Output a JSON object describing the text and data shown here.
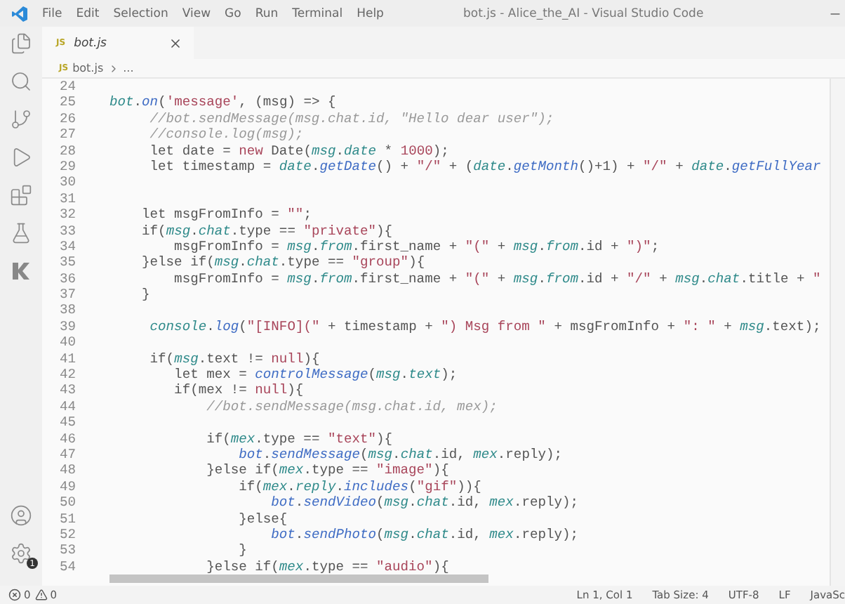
{
  "window": {
    "title": "bot.js - Alice_the_AI - Visual Studio Code"
  },
  "menu": [
    "File",
    "Edit",
    "Selection",
    "View",
    "Go",
    "Run",
    "Terminal",
    "Help"
  ],
  "activity_bar": {
    "items": [
      {
        "kind": "files"
      },
      {
        "kind": "search"
      },
      {
        "kind": "source-control"
      },
      {
        "kind": "run"
      },
      {
        "kind": "extensions"
      },
      {
        "kind": "testing"
      },
      {
        "kind": "k-logo"
      }
    ],
    "bottom": [
      {
        "kind": "account"
      },
      {
        "kind": "settings",
        "badge": "1"
      }
    ]
  },
  "tabs": [
    {
      "icon_text": "JS",
      "label": "bot.js",
      "selected": true
    }
  ],
  "breadcrumb": {
    "icon_text": "JS",
    "file": "bot.js",
    "rest": "..."
  },
  "editor": {
    "lines": [
      {
        "number": "24"
      },
      {
        "number": "25",
        "tokens": [
          {
            "text": "bot",
            "kind": "var"
          },
          {
            "text": ".",
            "kind": "text"
          },
          {
            "text": "on",
            "kind": "func"
          },
          {
            "text": "(",
            "kind": "text"
          },
          {
            "text": "'message'",
            "kind": "string"
          },
          {
            "text": ", (msg) => {",
            "kind": "text"
          }
        ]
      },
      {
        "number": "26",
        "tokens": [
          {
            "text": "     //bot.sendMessage(msg.chat.id, \"Hello dear user\");",
            "kind": "comment"
          }
        ]
      },
      {
        "number": "27",
        "tokens": [
          {
            "text": "     //console.log(msg);",
            "kind": "comment"
          }
        ]
      },
      {
        "number": "28",
        "tokens": [
          {
            "text": "     let date = ",
            "kind": "text"
          },
          {
            "text": "new",
            "kind": "keyword"
          },
          {
            "text": " Date(",
            "kind": "text"
          },
          {
            "text": "msg",
            "kind": "var"
          },
          {
            "text": ".",
            "kind": "text"
          },
          {
            "text": "date",
            "kind": "var"
          },
          {
            "text": " * ",
            "kind": "text"
          },
          {
            "text": "1000",
            "kind": "number"
          },
          {
            "text": ");",
            "kind": "text"
          }
        ]
      },
      {
        "number": "29",
        "tokens": [
          {
            "text": "     let timestamp = ",
            "kind": "text"
          },
          {
            "text": "date",
            "kind": "var"
          },
          {
            "text": ".",
            "kind": "text"
          },
          {
            "text": "getDate",
            "kind": "func"
          },
          {
            "text": "() + ",
            "kind": "text"
          },
          {
            "text": "\"/\"",
            "kind": "string"
          },
          {
            "text": " + (",
            "kind": "text"
          },
          {
            "text": "date",
            "kind": "var"
          },
          {
            "text": ".",
            "kind": "text"
          },
          {
            "text": "getMonth",
            "kind": "func"
          },
          {
            "text": "()+1) + ",
            "kind": "text"
          },
          {
            "text": "\"/\"",
            "kind": "string"
          },
          {
            "text": " + ",
            "kind": "text"
          },
          {
            "text": "date",
            "kind": "var"
          },
          {
            "text": ".",
            "kind": "text"
          },
          {
            "text": "getFullYear",
            "kind": "func"
          }
        ]
      },
      {
        "number": "30"
      },
      {
        "number": "31"
      },
      {
        "number": "32",
        "tokens": [
          {
            "text": "    let msgFromInfo = ",
            "kind": "text"
          },
          {
            "text": "\"\"",
            "kind": "string"
          },
          {
            "text": ";",
            "kind": "text"
          }
        ]
      },
      {
        "number": "33",
        "tokens": [
          {
            "text": "    if(",
            "kind": "text"
          },
          {
            "text": "msg",
            "kind": "var"
          },
          {
            "text": ".",
            "kind": "text"
          },
          {
            "text": "chat",
            "kind": "var"
          },
          {
            "text": ".type == ",
            "kind": "text"
          },
          {
            "text": "\"private\"",
            "kind": "string"
          },
          {
            "text": "){",
            "kind": "text"
          }
        ]
      },
      {
        "number": "34",
        "tokens": [
          {
            "text": "        msgFromInfo = ",
            "kind": "text"
          },
          {
            "text": "msg",
            "kind": "var"
          },
          {
            "text": ".",
            "kind": "text"
          },
          {
            "text": "from",
            "kind": "var"
          },
          {
            "text": ".first_name + ",
            "kind": "text"
          },
          {
            "text": "\"(\"",
            "kind": "string"
          },
          {
            "text": " + ",
            "kind": "text"
          },
          {
            "text": "msg",
            "kind": "var"
          },
          {
            "text": ".",
            "kind": "text"
          },
          {
            "text": "from",
            "kind": "var"
          },
          {
            "text": ".id + ",
            "kind": "text"
          },
          {
            "text": "\")\"",
            "kind": "string"
          },
          {
            "text": ";",
            "kind": "text"
          }
        ]
      },
      {
        "number": "35",
        "tokens": [
          {
            "text": "    }else if(",
            "kind": "text"
          },
          {
            "text": "msg",
            "kind": "var"
          },
          {
            "text": ".",
            "kind": "text"
          },
          {
            "text": "chat",
            "kind": "var"
          },
          {
            "text": ".type == ",
            "kind": "text"
          },
          {
            "text": "\"group\"",
            "kind": "string"
          },
          {
            "text": "){",
            "kind": "text"
          }
        ]
      },
      {
        "number": "36",
        "tokens": [
          {
            "text": "        msgFromInfo = ",
            "kind": "text"
          },
          {
            "text": "msg",
            "kind": "var"
          },
          {
            "text": ".",
            "kind": "text"
          },
          {
            "text": "from",
            "kind": "var"
          },
          {
            "text": ".first_name + ",
            "kind": "text"
          },
          {
            "text": "\"(\"",
            "kind": "string"
          },
          {
            "text": " + ",
            "kind": "text"
          },
          {
            "text": "msg",
            "kind": "var"
          },
          {
            "text": ".",
            "kind": "text"
          },
          {
            "text": "from",
            "kind": "var"
          },
          {
            "text": ".id + ",
            "kind": "text"
          },
          {
            "text": "\"/\"",
            "kind": "string"
          },
          {
            "text": " + ",
            "kind": "text"
          },
          {
            "text": "msg",
            "kind": "var"
          },
          {
            "text": ".",
            "kind": "text"
          },
          {
            "text": "chat",
            "kind": "var"
          },
          {
            "text": ".title + ",
            "kind": "text"
          },
          {
            "text": "\"",
            "kind": "string"
          }
        ]
      },
      {
        "number": "37",
        "tokens": [
          {
            "text": "    }",
            "kind": "text"
          }
        ]
      },
      {
        "number": "38"
      },
      {
        "number": "39",
        "tokens": [
          {
            "text": "     console",
            "kind": "var"
          },
          {
            "text": ".",
            "kind": "text"
          },
          {
            "text": "log",
            "kind": "func"
          },
          {
            "text": "(",
            "kind": "text"
          },
          {
            "text": "\"[INFO](\"",
            "kind": "string"
          },
          {
            "text": " + timestamp + ",
            "kind": "text"
          },
          {
            "text": "\") Msg from \"",
            "kind": "string"
          },
          {
            "text": " + msgFromInfo + ",
            "kind": "text"
          },
          {
            "text": "\": \"",
            "kind": "string"
          },
          {
            "text": " + ",
            "kind": "text"
          },
          {
            "text": "msg",
            "kind": "var"
          },
          {
            "text": ".text);",
            "kind": "text"
          }
        ]
      },
      {
        "number": "40"
      },
      {
        "number": "41",
        "tokens": [
          {
            "text": "     if(",
            "kind": "text"
          },
          {
            "text": "msg",
            "kind": "var"
          },
          {
            "text": ".text != ",
            "kind": "text"
          },
          {
            "text": "null",
            "kind": "keyword"
          },
          {
            "text": "){",
            "kind": "text"
          }
        ]
      },
      {
        "number": "42",
        "tokens": [
          {
            "text": "        let mex = ",
            "kind": "text"
          },
          {
            "text": "controlMessage",
            "kind": "func"
          },
          {
            "text": "(",
            "kind": "text"
          },
          {
            "text": "msg",
            "kind": "var"
          },
          {
            "text": ".",
            "kind": "text"
          },
          {
            "text": "text",
            "kind": "var"
          },
          {
            "text": ");",
            "kind": "text"
          }
        ]
      },
      {
        "number": "43",
        "tokens": [
          {
            "text": "        if(mex != ",
            "kind": "text"
          },
          {
            "text": "null",
            "kind": "keyword"
          },
          {
            "text": "){",
            "kind": "text"
          }
        ]
      },
      {
        "number": "44",
        "tokens": [
          {
            "text": "            //bot.sendMessage(msg.chat.id, mex);",
            "kind": "comment"
          }
        ]
      },
      {
        "number": "45"
      },
      {
        "number": "46",
        "tokens": [
          {
            "text": "            if(",
            "kind": "text"
          },
          {
            "text": "mex",
            "kind": "var"
          },
          {
            "text": ".type == ",
            "kind": "text"
          },
          {
            "text": "\"text\"",
            "kind": "string"
          },
          {
            "text": "){",
            "kind": "text"
          }
        ]
      },
      {
        "number": "47",
        "tokens": [
          {
            "text": "                bot",
            "kind": "func"
          },
          {
            "text": ".",
            "kind": "text"
          },
          {
            "text": "sendMessage",
            "kind": "func"
          },
          {
            "text": "(",
            "kind": "text"
          },
          {
            "text": "msg",
            "kind": "var"
          },
          {
            "text": ".",
            "kind": "text"
          },
          {
            "text": "chat",
            "kind": "var"
          },
          {
            "text": ".id, ",
            "kind": "text"
          },
          {
            "text": "mex",
            "kind": "var"
          },
          {
            "text": ".reply);",
            "kind": "text"
          }
        ]
      },
      {
        "number": "48",
        "tokens": [
          {
            "text": "            }else if(",
            "kind": "text"
          },
          {
            "text": "mex",
            "kind": "var"
          },
          {
            "text": ".type == ",
            "kind": "text"
          },
          {
            "text": "\"image\"",
            "kind": "string"
          },
          {
            "text": "){",
            "kind": "text"
          }
        ]
      },
      {
        "number": "49",
        "tokens": [
          {
            "text": "                if(",
            "kind": "text"
          },
          {
            "text": "mex",
            "kind": "var"
          },
          {
            "text": ".",
            "kind": "text"
          },
          {
            "text": "reply",
            "kind": "var"
          },
          {
            "text": ".",
            "kind": "text"
          },
          {
            "text": "includes",
            "kind": "func"
          },
          {
            "text": "(",
            "kind": "text"
          },
          {
            "text": "\"gif\"",
            "kind": "string"
          },
          {
            "text": ")){",
            "kind": "text"
          }
        ]
      },
      {
        "number": "50",
        "tokens": [
          {
            "text": "                    bot",
            "kind": "func"
          },
          {
            "text": ".",
            "kind": "text"
          },
          {
            "text": "sendVideo",
            "kind": "func"
          },
          {
            "text": "(",
            "kind": "text"
          },
          {
            "text": "msg",
            "kind": "var"
          },
          {
            "text": ".",
            "kind": "text"
          },
          {
            "text": "chat",
            "kind": "var"
          },
          {
            "text": ".id, ",
            "kind": "text"
          },
          {
            "text": "mex",
            "kind": "var"
          },
          {
            "text": ".reply);",
            "kind": "text"
          }
        ]
      },
      {
        "number": "51",
        "tokens": [
          {
            "text": "                }else{",
            "kind": "text"
          }
        ]
      },
      {
        "number": "52",
        "tokens": [
          {
            "text": "                    bot",
            "kind": "func"
          },
          {
            "text": ".",
            "kind": "text"
          },
          {
            "text": "sendPhoto",
            "kind": "func"
          },
          {
            "text": "(",
            "kind": "text"
          },
          {
            "text": "msg",
            "kind": "var"
          },
          {
            "text": ".",
            "kind": "text"
          },
          {
            "text": "chat",
            "kind": "var"
          },
          {
            "text": ".id, ",
            "kind": "text"
          },
          {
            "text": "mex",
            "kind": "var"
          },
          {
            "text": ".reply);",
            "kind": "text"
          }
        ]
      },
      {
        "number": "53",
        "tokens": [
          {
            "text": "                }",
            "kind": "text"
          }
        ]
      },
      {
        "number": "54",
        "tokens": [
          {
            "text": "            }else if(",
            "kind": "text"
          },
          {
            "text": "mex",
            "kind": "var"
          },
          {
            "text": ".type == ",
            "kind": "text"
          },
          {
            "text": "\"audio\"",
            "kind": "string"
          },
          {
            "text": "){",
            "kind": "text"
          }
        ]
      }
    ]
  },
  "status_bar": {
    "errors": "0",
    "warnings": "0",
    "items": [
      "Ln 1, Col 1",
      "Tab Size: 4",
      "UTF-8",
      "LF",
      "JavaSc"
    ]
  }
}
